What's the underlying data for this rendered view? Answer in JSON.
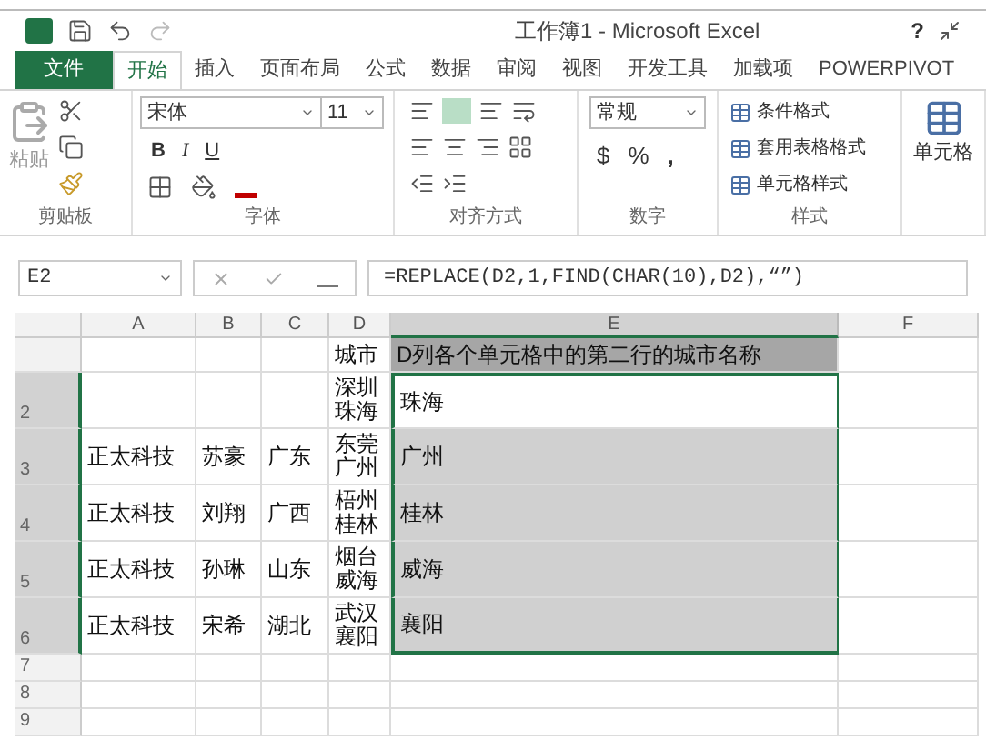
{
  "window": {
    "title": "工作簿1 - Microsoft Excel",
    "help": "?"
  },
  "tabs": [
    {
      "label": "文件",
      "kind": "file",
      "selected": false
    },
    {
      "label": "开始",
      "kind": "tab",
      "selected": true
    },
    {
      "label": "插入",
      "kind": "tab",
      "selected": false
    },
    {
      "label": "页面布局",
      "kind": "tab",
      "selected": false
    },
    {
      "label": "公式",
      "kind": "tab",
      "selected": false
    },
    {
      "label": "数据",
      "kind": "tab",
      "selected": false
    },
    {
      "label": "审阅",
      "kind": "tab",
      "selected": false
    },
    {
      "label": "视图",
      "kind": "tab",
      "selected": false
    },
    {
      "label": "开发工具",
      "kind": "tab",
      "selected": false
    },
    {
      "label": "加载项",
      "kind": "tab",
      "selected": false
    },
    {
      "label": "POWERPIVOT",
      "kind": "tab",
      "selected": false
    }
  ],
  "ribbon": {
    "paste": "粘贴",
    "font_name": "宋体",
    "font_size": "11",
    "bold": "B",
    "italic": "I",
    "underline": "U",
    "number_format": "常规",
    "currency": "$",
    "percent": "%",
    "comma": ",",
    "styles": [
      "条件格式",
      "套用表格格式",
      "单元格样式"
    ],
    "cells": "单元格",
    "groups": [
      "剪贴板",
      "字体",
      "对齐方式",
      "数字",
      "样式"
    ]
  },
  "name_box": "E2",
  "formula": "=REPLACE(D2,1,FIND(CHAR(10),D2),“”)",
  "sheet": {
    "columns": [
      {
        "label": "A",
        "selected": false
      },
      {
        "label": "B",
        "selected": false
      },
      {
        "label": "C",
        "selected": false
      },
      {
        "label": "D",
        "selected": false
      },
      {
        "label": "E",
        "selected": true
      },
      {
        "label": "F",
        "selected": false
      }
    ],
    "rows": [
      {
        "kind": "heading",
        "selected": false,
        "active": false,
        "cells": [
          null,
          null,
          null,
          "城市",
          "D列各个单元格中的第二行的城市名称",
          null
        ]
      },
      {
        "number": "2",
        "kind": "data",
        "selected": true,
        "active": true,
        "cells": [
          null,
          null,
          null,
          "深圳珠海",
          "珠海",
          null
        ]
      },
      {
        "number": "3",
        "kind": "data",
        "selected": true,
        "active": false,
        "cells": [
          "正太科技",
          "苏豪",
          "广东",
          "东莞广州",
          "广州",
          null
        ]
      },
      {
        "number": "4",
        "kind": "data",
        "selected": true,
        "active": false,
        "cells": [
          "正太科技",
          "刘翔",
          "广西",
          "梧州桂林",
          "桂林",
          null
        ]
      },
      {
        "number": "5",
        "kind": "data",
        "selected": true,
        "active": false,
        "cells": [
          "正太科技",
          "孙琳",
          "山东",
          "烟台威海",
          "威海",
          null
        ]
      },
      {
        "number": "6",
        "kind": "data",
        "selected": true,
        "active": false,
        "cells": [
          "正太科技",
          "宋希",
          "湖北",
          "武汉襄阳",
          "襄阳",
          null
        ]
      },
      {
        "number": "7",
        "kind": "empty",
        "selected": false,
        "active": false,
        "cells": []
      },
      {
        "number": "8",
        "kind": "empty",
        "selected": false,
        "active": false,
        "cells": []
      },
      {
        "number": "9",
        "kind": "empty",
        "selected": false,
        "active": false,
        "cells": []
      }
    ]
  }
}
